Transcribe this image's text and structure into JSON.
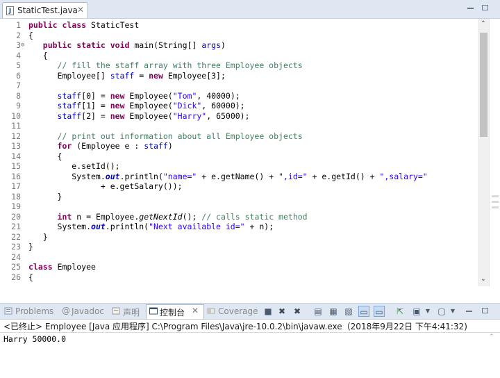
{
  "editor": {
    "tab_title": "StaticTest.java",
    "tab_close": "✕",
    "file_icon": "J"
  },
  "code_lines": [
    {
      "n": "1",
      "t": "public class StaticTest"
    },
    {
      "n": "2",
      "t": "{"
    },
    {
      "n": "3",
      "t": "   public static void main(String[] args)"
    },
    {
      "n": "4",
      "t": "   {"
    },
    {
      "n": "5",
      "t": "      // fill the staff array with three Employee objects"
    },
    {
      "n": "6",
      "t": "      Employee[] staff = new Employee[3];"
    },
    {
      "n": "7",
      "t": ""
    },
    {
      "n": "8",
      "t": "      staff[0] = new Employee(\"Tom\", 40000);"
    },
    {
      "n": "9",
      "t": "      staff[1] = new Employee(\"Dick\", 60000);"
    },
    {
      "n": "10",
      "t": "      staff[2] = new Employee(\"Harry\", 65000);"
    },
    {
      "n": "11",
      "t": ""
    },
    {
      "n": "12",
      "t": "      // print out information about all Employee objects"
    },
    {
      "n": "13",
      "t": "      for (Employee e : staff)"
    },
    {
      "n": "14",
      "t": "      {"
    },
    {
      "n": "15",
      "t": "         e.setId();"
    },
    {
      "n": "16",
      "t": "         System.out.println(\"name=\" + e.getName() + \",id=\" + e.getId() + \",salary=\""
    },
    {
      "n": "17",
      "t": "               + e.getSalary());"
    },
    {
      "n": "18",
      "t": "      }"
    },
    {
      "n": "19",
      "t": ""
    },
    {
      "n": "20",
      "t": "      int n = Employee.getNextId(); // calls static method"
    },
    {
      "n": "21",
      "t": "      System.out.println(\"Next available id=\" + n);"
    },
    {
      "n": "22",
      "t": "   }"
    },
    {
      "n": "23",
      "t": "}"
    },
    {
      "n": "24",
      "t": ""
    },
    {
      "n": "25",
      "t": "class Employee"
    },
    {
      "n": "26",
      "t": "{"
    }
  ],
  "console": {
    "tabs": [
      {
        "label": "Problems",
        "icon": "problems-icon"
      },
      {
        "label": "Javadoc",
        "icon": "javadoc-icon"
      },
      {
        "label": "声明",
        "icon": "declaration-icon"
      },
      {
        "label": "控制台",
        "icon": "console-icon"
      },
      {
        "label": "Coverage",
        "icon": "coverage-icon"
      }
    ],
    "active_tab_close": "✕",
    "status": "<已终止> Employee [Java 应用程序] C:\\Program Files\\Java\\jre-10.0.2\\bin\\javaw.exe（2018年9月22日 下午4:41:32)",
    "output": "Harry 50000.0"
  },
  "colors": {
    "keyword": "#7f0055",
    "comment": "#3f7f5f",
    "string": "#2a00ff",
    "field": "#0000c0",
    "tabbar": "#dfe7f3"
  }
}
